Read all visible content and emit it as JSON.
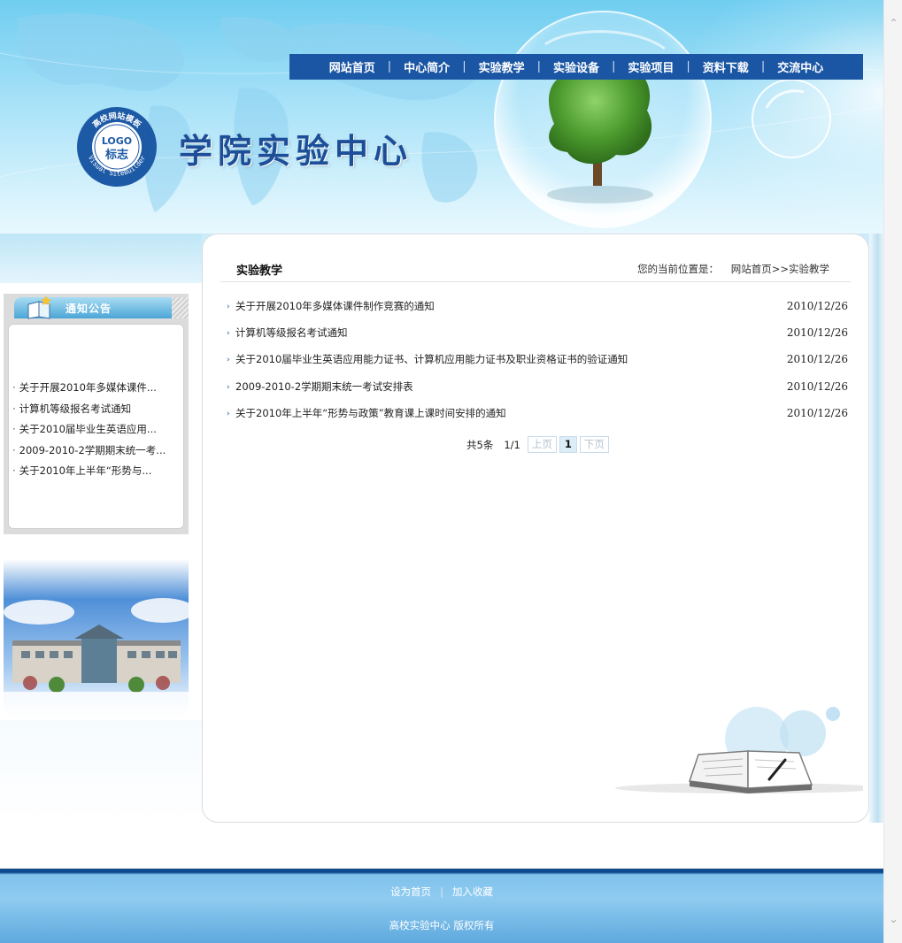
{
  "header": {
    "site_title": "学院实验中心",
    "logo": {
      "top_text": "高校网站模板",
      "center_text": "LOGO",
      "sub_text": "标志",
      "bottom_text": "Visual SiteBuilder"
    }
  },
  "nav": {
    "items": [
      {
        "label": "网站首页"
      },
      {
        "label": "中心简介"
      },
      {
        "label": "实验教学"
      },
      {
        "label": "实验设备"
      },
      {
        "label": "实验项目"
      },
      {
        "label": "资料下载"
      },
      {
        "label": "交流中心"
      }
    ],
    "separator": "|"
  },
  "sidebar": {
    "notice_title": "通知公告",
    "notices": [
      "关于开展2010年多媒体课件...",
      "计算机等级报名考试通知",
      "关于2010届毕业生英语应用...",
      "2009-2010-2学期期末统一考...",
      "关于2010年上半年“形势与..."
    ]
  },
  "main": {
    "title": "实验教学",
    "breadcrumb": {
      "label": "您的当前位置是：",
      "home": "网站首页",
      "separator": ">>",
      "current": "实验教学"
    },
    "articles": [
      {
        "title": "关于开展2010年多媒体课件制作竞赛的通知",
        "date": "2010/12/26"
      },
      {
        "title": "计算机等级报名考试通知",
        "date": "2010/12/26"
      },
      {
        "title": "关于2010届毕业生英语应用能力证书、计算机应用能力证书及职业资格证书的验证通知",
        "date": "2010/12/26"
      },
      {
        "title": "2009-2010-2学期期末统一考试安排表",
        "date": "2010/12/26"
      },
      {
        "title": "关于2010年上半年“形势与政策”教育课上课时间安排的通知",
        "date": "2010/12/26"
      }
    ],
    "pager": {
      "total": "共5条",
      "pages": "1/1",
      "prev": "上页",
      "current": "1",
      "next": "下页"
    }
  },
  "footer": {
    "set_home": "设为首页",
    "separator": "|",
    "add_favorite": "加入收藏",
    "copyright": "高校实验中心  版权所有"
  },
  "colors": {
    "nav_bg": "#1a56a4",
    "title_blue": "#1d4f99",
    "footer_dark": "#0e4a8e",
    "footer_light": "#8fcbf0"
  },
  "icons": {
    "nav_scroll_up": "chevron-up-icon",
    "nav_scroll_down": "chevron-down-icon",
    "list_bullet": "arrow-right-icon"
  }
}
